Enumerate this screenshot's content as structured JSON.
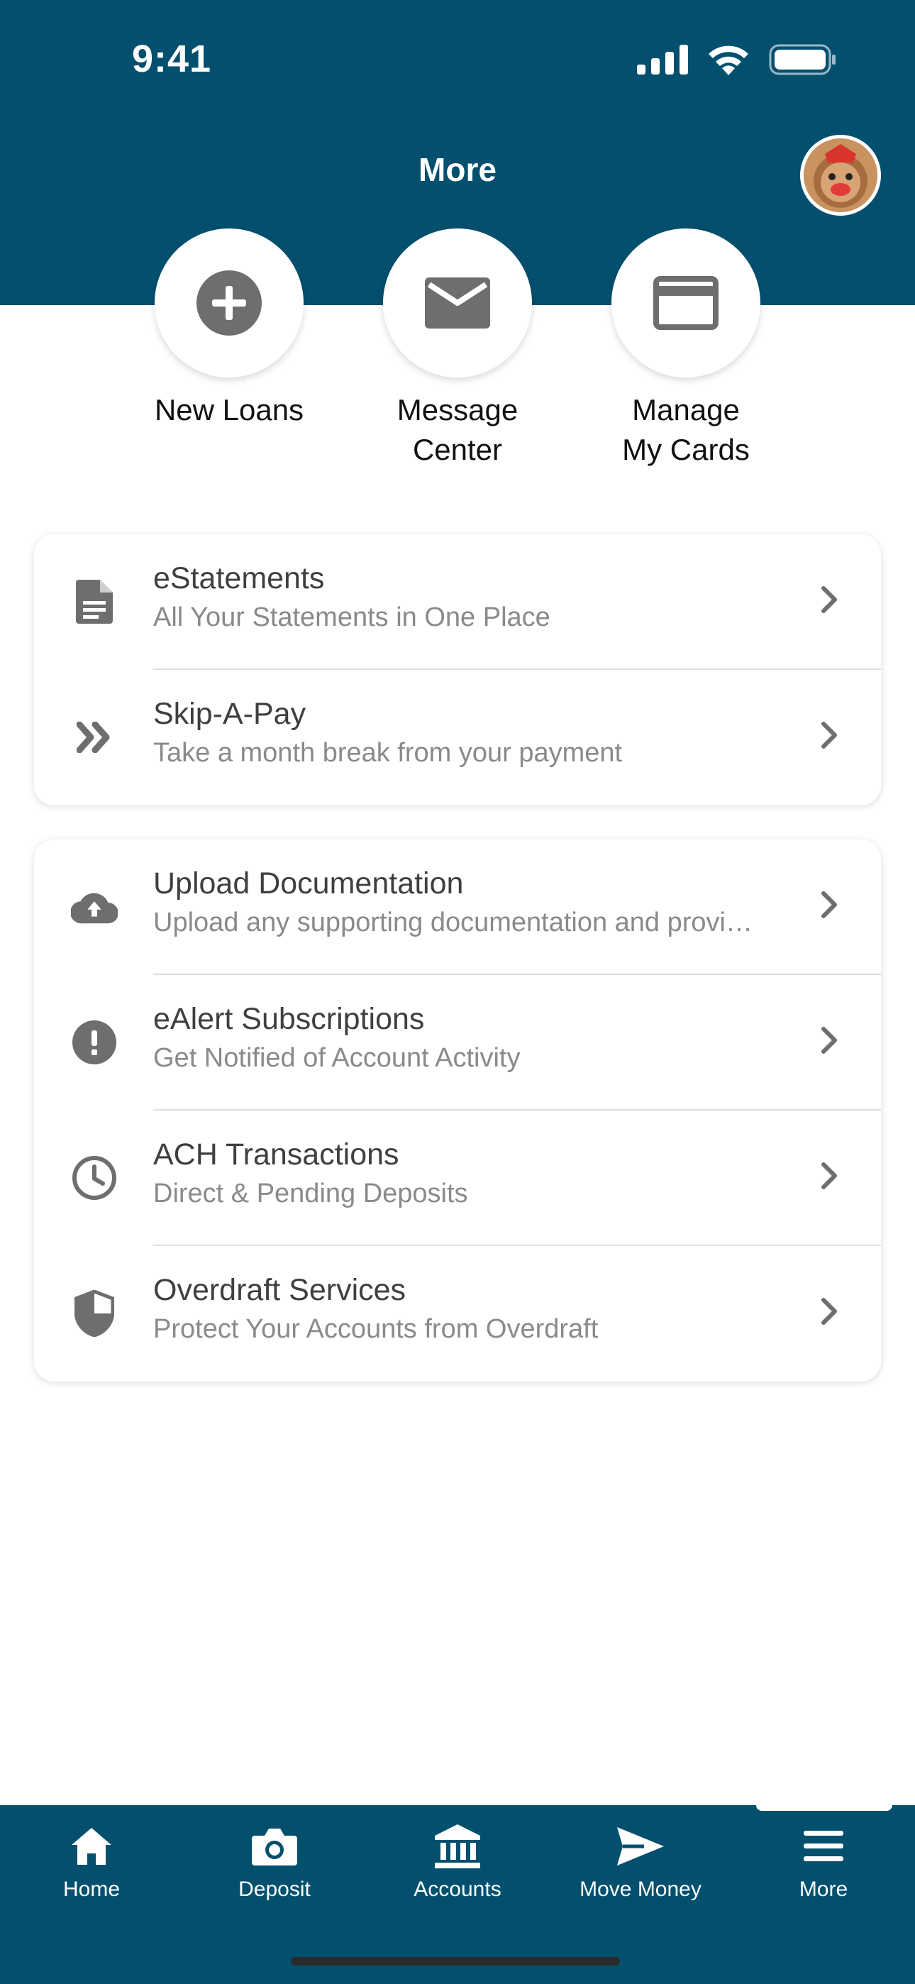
{
  "status_bar": {
    "time": "9:41"
  },
  "header": {
    "title": "More"
  },
  "quick_actions": [
    {
      "label_line1": "New Loans",
      "label_line2": "",
      "icon": "plus-circle-icon"
    },
    {
      "label_line1": "Message",
      "label_line2": "Center",
      "icon": "envelope-icon"
    },
    {
      "label_line1": "Manage",
      "label_line2": "My Cards",
      "icon": "credit-card-icon"
    }
  ],
  "menu_group_1": [
    {
      "title": "eStatements",
      "subtitle": "All Your Statements in One Place",
      "icon": "document-icon"
    },
    {
      "title": "Skip-A-Pay",
      "subtitle": "Take a month break from your payment",
      "icon": "double-chevron-icon"
    }
  ],
  "menu_group_2": [
    {
      "title": "Upload Documentation",
      "subtitle": "Upload any supporting documentation and provi…",
      "icon": "cloud-upload-icon"
    },
    {
      "title": "eAlert Subscriptions",
      "subtitle": "Get Notified of Account Activity",
      "icon": "alert-circle-icon"
    },
    {
      "title": "ACH Transactions",
      "subtitle": "Direct & Pending Deposits",
      "icon": "clock-icon"
    },
    {
      "title": "Overdraft Services",
      "subtitle": "Protect Your Accounts from Overdraft",
      "icon": "shield-icon"
    }
  ],
  "tab_bar": [
    {
      "label": "Home",
      "icon": "home-icon"
    },
    {
      "label": "Deposit",
      "icon": "camera-icon"
    },
    {
      "label": "Accounts",
      "icon": "bank-icon"
    },
    {
      "label": "Move Money",
      "icon": "send-icon"
    },
    {
      "label": "More",
      "icon": "menu-icon",
      "active": true
    }
  ],
  "colors": {
    "brand": "#03506e",
    "icon_gray": "#6e6e6e",
    "subtitle_gray": "#8a8a8a"
  }
}
